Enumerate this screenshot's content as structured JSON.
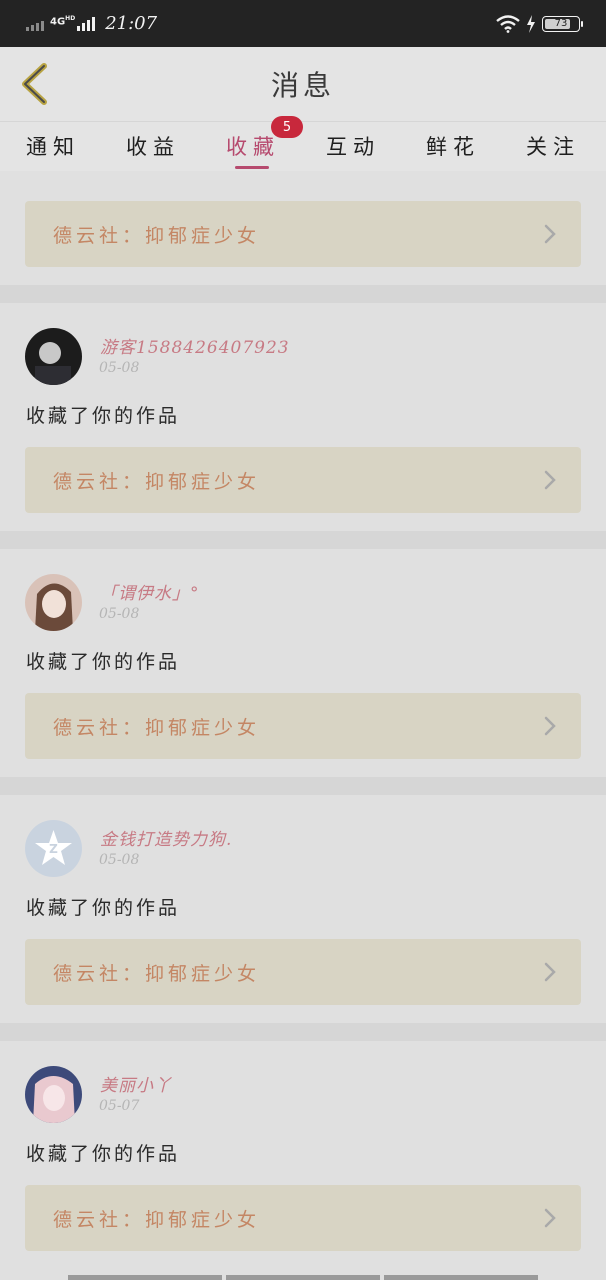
{
  "status_bar": {
    "network": "4G",
    "network_sup": "HD",
    "time": "21:07",
    "battery": "73"
  },
  "header": {
    "title": "消息",
    "back_icon": "chevron-left-icon"
  },
  "tabs": [
    {
      "label": "通知"
    },
    {
      "label": "收益"
    },
    {
      "label": "收藏",
      "active": true,
      "badge": "5"
    },
    {
      "label": "互动"
    },
    {
      "label": "鲜花"
    },
    {
      "label": "关注"
    }
  ],
  "feed": {
    "first_partial": {
      "work": "德云社：抑郁症少女"
    },
    "items": [
      {
        "username": "游客15884264079​23",
        "date": "05-08",
        "action": "收藏了你的作品",
        "work": "德云社：抑郁症少女",
        "avatar_colors": [
          "#1c1c1c",
          "#c8c8c8"
        ]
      },
      {
        "username": "「谓伊水」°",
        "date": "05-08",
        "action": "收藏了你的作品",
        "work": "德云社：抑郁症少女",
        "avatar_colors": [
          "#6b4a3a",
          "#d9c2b8"
        ]
      },
      {
        "username": "金钱打造势力狗.",
        "date": "05-08",
        "action": "收藏了你的作品",
        "work": "德云社：抑郁症少女",
        "avatar_colors": [
          "#c9d3df",
          "#ffffff"
        ]
      },
      {
        "username": "美丽小丫",
        "date": "05-07",
        "action": "收藏了你的作品",
        "work": "德云社：抑郁症少女",
        "avatar_colors": [
          "#3d4a7a",
          "#f1d2d6"
        ]
      }
    ]
  },
  "colors": {
    "accent": "#b64a6e",
    "badge": "#c8283c",
    "work_text": "#c48664",
    "username": "#c77a84"
  }
}
